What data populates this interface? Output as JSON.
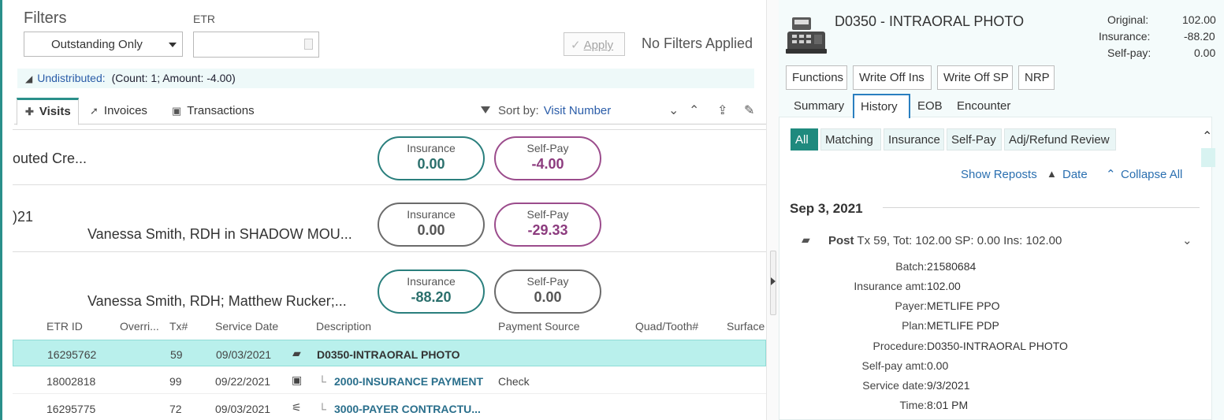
{
  "filters": {
    "title": "Filters",
    "etr_label": "ETR",
    "status_select": "Outstanding Only",
    "etr_value": "",
    "apply_label": "Apply",
    "status_text": "No Filters Applied"
  },
  "undistributed": {
    "label": "Undistributed:",
    "detail": "(Count: 1; Amount: -4.00)"
  },
  "tabs": [
    {
      "label": "Visits",
      "icon": "medical-bag-icon"
    },
    {
      "label": "Invoices",
      "icon": "pin-icon"
    },
    {
      "label": "Transactions",
      "icon": "money-icon"
    }
  ],
  "sort": {
    "label": "Sort by:",
    "value": "Visit Number"
  },
  "visits": [
    {
      "text1": "outed Cre...",
      "text2": "",
      "insurance_label": "Insurance",
      "insurance": "0.00",
      "selfpay_label": "Self-Pay",
      "selfpay": "-4.00"
    },
    {
      "text1": ")21",
      "text2": "Vanessa Smith, RDH in SHADOW MOU...",
      "insurance_label": "Insurance",
      "insurance": "0.00",
      "selfpay_label": "Self-Pay",
      "selfpay": "-29.33"
    },
    {
      "text1": "",
      "text2": "Vanessa Smith, RDH; Matthew Rucker;...",
      "insurance_label": "Insurance",
      "insurance": "-88.20",
      "selfpay_label": "Self-Pay",
      "selfpay": "0.00"
    }
  ],
  "table": {
    "headers": [
      "ETR ID",
      "Overri...",
      "Tx#",
      "Service Date",
      "Description",
      "Payment Source",
      "Quad/Tooth#",
      "Surface"
    ],
    "rows": [
      {
        "etr": "16295762",
        "tx": "59",
        "date": "09/03/2021",
        "desc": "D0350-INTRAORAL PHOTO",
        "source": "",
        "icon": "register-icon"
      },
      {
        "etr": "18002818",
        "tx": "99",
        "date": "09/22/2021",
        "desc": "2000-INSURANCE PAYMENT",
        "source": "Check",
        "icon": "money-icon"
      },
      {
        "etr": "16295775",
        "tx": "72",
        "date": "09/03/2021",
        "desc": "3000-PAYER CONTRACTU...",
        "source": "",
        "icon": "adjust-icon"
      }
    ]
  },
  "detail_panel": {
    "title": "D0350 - INTRAORAL PHOTO",
    "summary": [
      {
        "label": "Original:",
        "value": "102.00"
      },
      {
        "label": "Insurance:",
        "value": "-88.20"
      },
      {
        "label": "Self-pay:",
        "value": "0.00"
      }
    ],
    "buttons": [
      "Functions",
      "Write Off Ins",
      "Write Off SP",
      "NRP"
    ],
    "tabs": [
      "Summary",
      "History",
      "EOB",
      "Encounter"
    ],
    "active_tab": "History",
    "filters": [
      "All",
      "Matching",
      "Insurance",
      "Self-Pay",
      "Adj/Refund Review"
    ],
    "links": {
      "show_reposts": "Show Reposts",
      "date": "Date",
      "collapse_all": "Collapse All"
    },
    "date_heading": "Sep 3, 2021",
    "entry": {
      "action": "Post",
      "summary": "Tx 59, Tot: 102.00 SP: 0.00 Ins: 102.00",
      "fields": [
        {
          "k": "Batch:",
          "v": "21580684"
        },
        {
          "k": "Insurance amt:",
          "v": "102.00"
        },
        {
          "k": "Payer:",
          "v": "METLIFE PPO"
        },
        {
          "k": "Plan:",
          "v": "METLIFE PDP"
        },
        {
          "k": "Procedure:",
          "v": "D0350-INTRAORAL PHOTO"
        },
        {
          "k": "Self-pay amt:",
          "v": "0.00"
        },
        {
          "k": "Service date:",
          "v": "9/3/2021"
        },
        {
          "k": "Time:",
          "v": "8:01 PM"
        }
      ]
    }
  },
  "colors": {
    "accent_teal": "#2a8f8a",
    "selfpay_purple": "#9b4c8c",
    "selected_row": "#b9f0ec",
    "link_blue": "#2a6fb0"
  }
}
